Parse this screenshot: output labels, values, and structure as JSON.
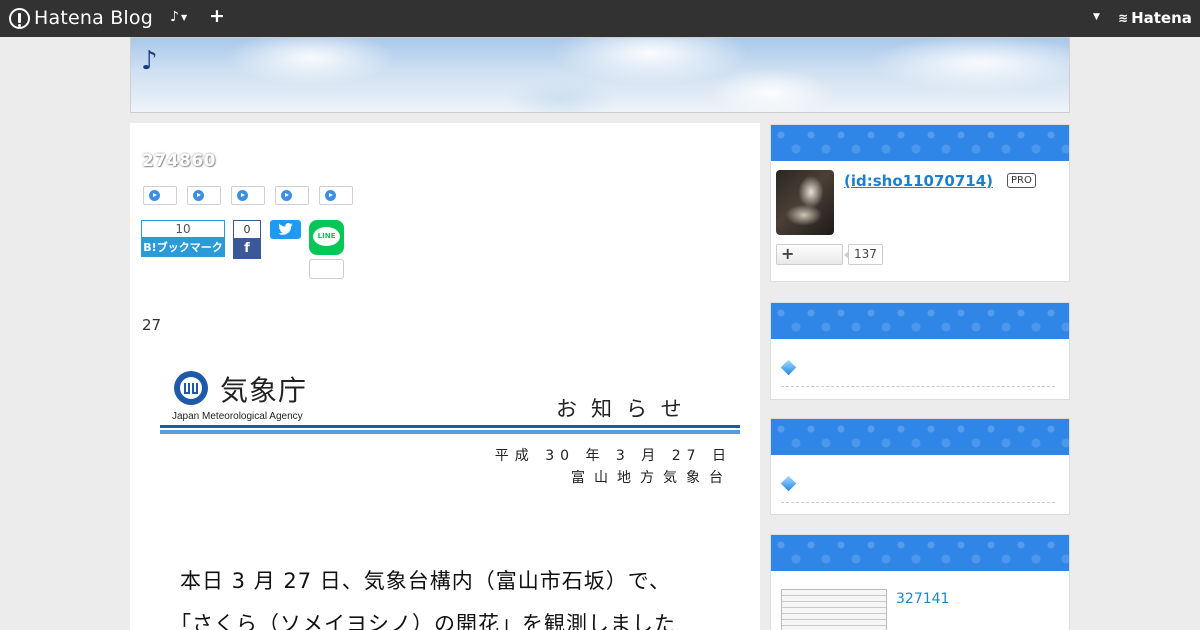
{
  "topbar": {
    "brand": "Hatena Blog",
    "note_menu": "♪",
    "add": "+",
    "hatena": "Hatena"
  },
  "blog": {
    "title": "♪"
  },
  "entry": {
    "title": "274860",
    "bookmark": {
      "count": "10",
      "label": "B!ブックマーク"
    },
    "facebook": {
      "count": "0",
      "label": "f"
    },
    "line": {
      "label": "LINE"
    },
    "text": "27"
  },
  "notice": {
    "agency_ja": "気象庁",
    "agency_en": "Japan Meteorological Agency",
    "heading": "お知らせ",
    "date": "平成 30 年 3 月 27 日",
    "org": "富山地方気象台",
    "body_line1": "本日 3 月 27 日、気象台構内（富山市石坂）で、",
    "body_line2": "「さくら（ソメイヨシノ）の開花」を観測しました"
  },
  "sidebar": {
    "profile": {
      "id_label": " (id:sho11070714)",
      "badge": "PRO",
      "follow_plus": "+",
      "follower_count": "137"
    },
    "thumb_count": "327141"
  },
  "colors": {
    "topbar": "#323232",
    "sidebar_header": "#2f86e6",
    "link": "#1e7fcf"
  }
}
